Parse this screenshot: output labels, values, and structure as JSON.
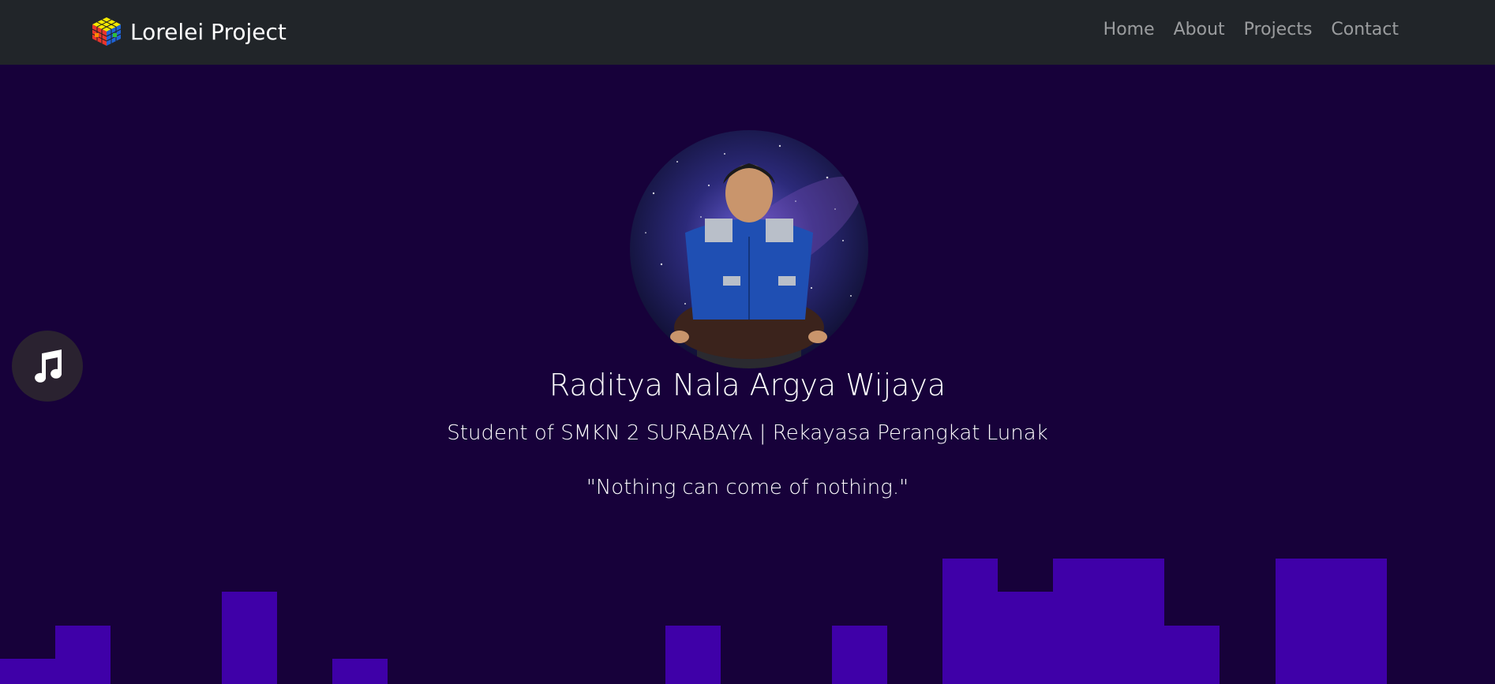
{
  "navbar": {
    "brand": "Lorelei Project",
    "links": [
      "Home",
      "About",
      "Projects",
      "Contact"
    ]
  },
  "profile": {
    "name": "Raditya Nala Argya Wijaya",
    "subtitle": "Student of SMKN 2 SURABAYA | Rekayasa Perangkat Lunak",
    "quote": "\"Nothing can come of nothing.\""
  },
  "music_button": {
    "icon": "music-note-icon"
  },
  "colors": {
    "background": "#17013a",
    "navbar": "#212529",
    "bars": "#3f00a8",
    "nav_link": "#8f9194"
  }
}
